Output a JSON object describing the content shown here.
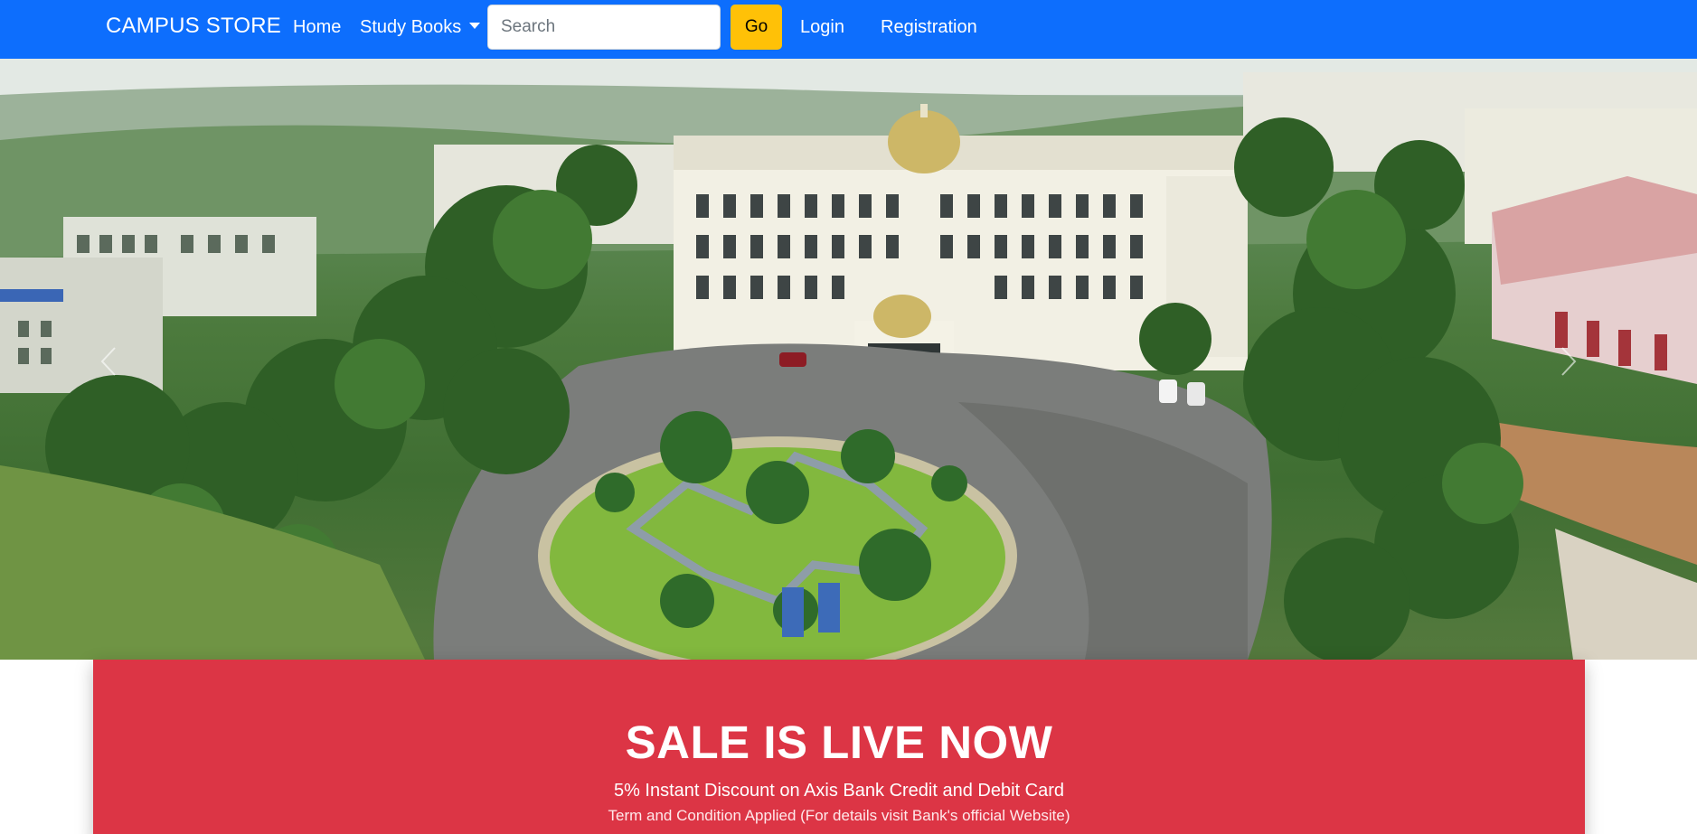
{
  "navbar": {
    "brand": "CAMPUS STORE",
    "links": {
      "home": "Home",
      "study_books": "Study Books",
      "login": "Login",
      "registration": "Registration"
    },
    "search": {
      "placeholder": "Search",
      "value": ""
    },
    "go_label": "Go",
    "colors": {
      "background": "#0d6efd",
      "go_button": "#ffc107"
    }
  },
  "hero": {
    "image": "aerial view of a college campus with a circular garden driveway",
    "controls": {
      "prev_icon": "chevron-left-icon",
      "next_icon": "chevron-right-icon"
    }
  },
  "sale_banner": {
    "title": "SALE IS LIVE NOW",
    "line1": "5% Instant Discount on Axis Bank Credit and Debit Card",
    "line2": "Term and Condition Applied (For details visit Bank's official Website)",
    "background": "#dc3545"
  }
}
